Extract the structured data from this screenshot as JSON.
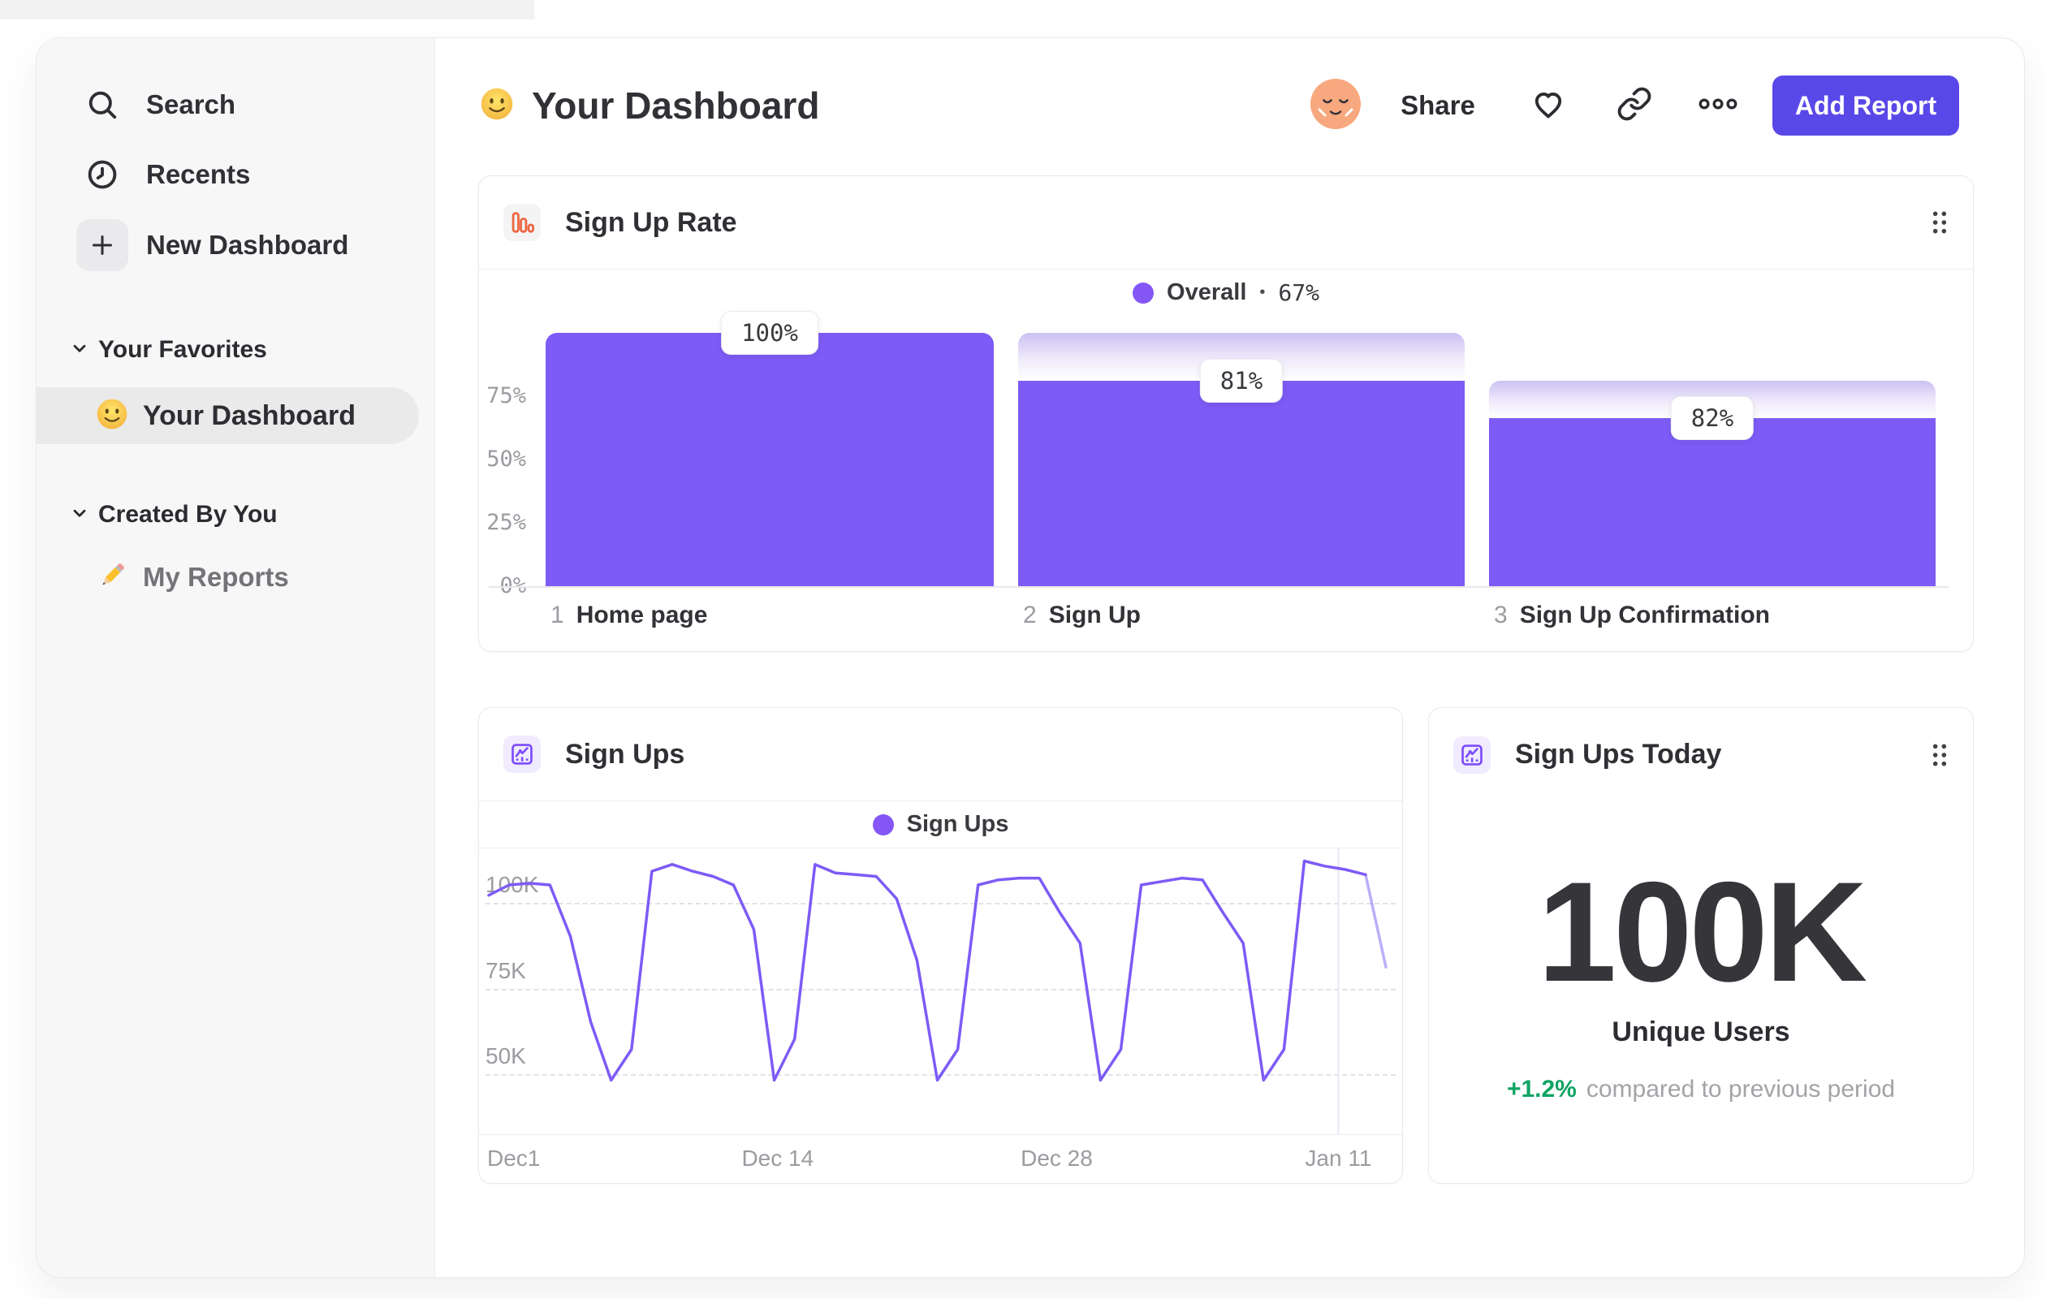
{
  "colors": {
    "accent_purple": "#7D5BF6",
    "legend_dot": "#8456F5",
    "button_indigo": "#5948E8",
    "positive_green": "#0FA463",
    "funnel_icon_orange": "#ED6742"
  },
  "sidebar": {
    "items": [
      {
        "icon": "search-icon",
        "label": "Search"
      },
      {
        "icon": "clock-icon",
        "label": "Recents"
      },
      {
        "icon": "plus-icon",
        "label": "New Dashboard"
      }
    ],
    "sections": [
      {
        "label": "Your Favorites",
        "items": [
          {
            "icon": "smiley-emoji",
            "label": "Your Dashboard",
            "selected": true
          }
        ]
      },
      {
        "label": "Created By You",
        "items": [
          {
            "icon": "pencil-emoji",
            "label": "My Reports",
            "selected": false
          }
        ]
      }
    ]
  },
  "header": {
    "emoji": "slightly-smiling-face",
    "title": "Your Dashboard",
    "share_label": "Share",
    "add_report_label": "Add Report"
  },
  "chart_data": [
    {
      "type": "bar",
      "subtype": "funnel",
      "title": "Sign Up Rate",
      "legend": {
        "series": "Overall",
        "sep": "•",
        "value": "67%"
      },
      "ylim": [
        0,
        100
      ],
      "grid": false,
      "y_ticks": [
        {
          "label": "75%",
          "value": 75
        },
        {
          "label": "50%",
          "value": 50
        },
        {
          "label": "25%",
          "value": 25
        },
        {
          "label": "0%",
          "value": 0
        }
      ],
      "steps": [
        {
          "num": "1",
          "name": "Home page",
          "label": "100%",
          "cumulative_pct": 100,
          "step_conversion_pct": 100
        },
        {
          "num": "2",
          "name": "Sign Up",
          "label": "81%",
          "cumulative_pct": 81,
          "step_conversion_pct": 81
        },
        {
          "num": "3",
          "name": "Sign Up Confirmation",
          "label": "82%",
          "cumulative_pct": 66.4,
          "step_conversion_pct": 82
        }
      ]
    },
    {
      "type": "line",
      "title": "Sign Ups",
      "legend": {
        "series": "Sign Ups"
      },
      "unit": "K",
      "ylim": [
        40,
        113
      ],
      "grid": "dashed-horizontal",
      "legend_position": "top-center",
      "y_ticks": [
        {
          "label": "100K",
          "value": 100
        },
        {
          "label": "75K",
          "value": 75
        },
        {
          "label": "50K",
          "value": 50
        }
      ],
      "x_ticks": [
        {
          "label": "Dec1",
          "frac": 0.0,
          "align": "left"
        },
        {
          "label": "Dec 14",
          "frac": 0.322,
          "align": "center"
        },
        {
          "label": "Dec 28",
          "frac": 0.633,
          "align": "center"
        },
        {
          "label": "Jan 11",
          "frac": 0.947,
          "align": "center"
        }
      ],
      "series": [
        {
          "name": "Sign Ups",
          "values": [
            97,
            100,
            100.5,
            100,
            85,
            60,
            43,
            52,
            104,
            106,
            104,
            102.5,
            100,
            87,
            43,
            55,
            106,
            103.5,
            103,
            102.5,
            96,
            78,
            43,
            52,
            100,
            101.5,
            102,
            102,
            92,
            83,
            43,
            52,
            100,
            101,
            102,
            101.5,
            92,
            83,
            43,
            52,
            107,
            105.5,
            104.5,
            103,
            76
          ]
        }
      ],
      "faded_tail_points": 2
    },
    {
      "type": "metric",
      "title": "Sign Ups Today",
      "value": "100K",
      "label": "Unique Users",
      "delta": "+1.2%",
      "delta_note": "compared to previous period"
    }
  ]
}
